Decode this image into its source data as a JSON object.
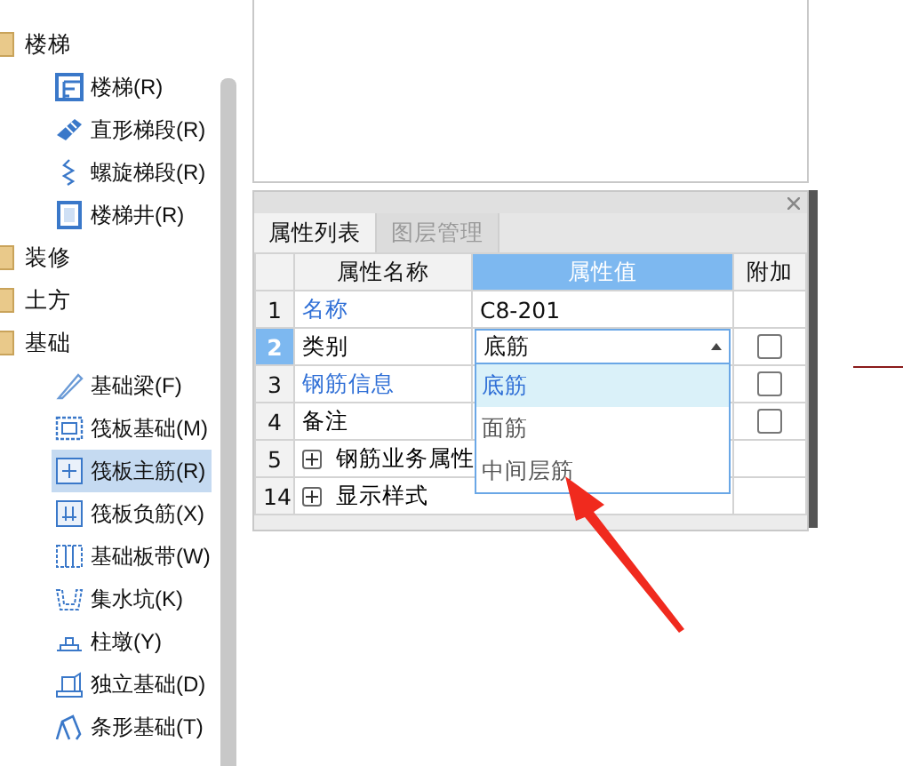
{
  "sidebar": {
    "items": [
      {
        "label": "楼梯",
        "children": [
          {
            "label": "楼梯(R)",
            "selected": false
          },
          {
            "label": "直形梯段(R)",
            "selected": false
          },
          {
            "label": "螺旋梯段(R)",
            "selected": false
          },
          {
            "label": "楼梯井(R)",
            "selected": false
          }
        ]
      },
      {
        "label": "装修"
      },
      {
        "label": "土方"
      },
      {
        "label": "基础",
        "children": [
          {
            "label": "基础梁(F)",
            "selected": false
          },
          {
            "label": "筏板基础(M)",
            "selected": false
          },
          {
            "label": "筏板主筋(R)",
            "selected": true
          },
          {
            "label": "筏板负筋(X)",
            "selected": false
          },
          {
            "label": "基础板带(W)",
            "selected": false
          },
          {
            "label": "集水坑(K)",
            "selected": false
          },
          {
            "label": "柱墩(Y)",
            "selected": false
          },
          {
            "label": "独立基础(D)",
            "selected": false
          },
          {
            "label": "条形基础(T)",
            "selected": false
          }
        ]
      }
    ]
  },
  "properties": {
    "tabs": [
      {
        "label": "属性列表",
        "selected": true
      },
      {
        "label": "图层管理",
        "selected": false
      }
    ],
    "columns": [
      {
        "label": "属性名称",
        "selected": false
      },
      {
        "label": "属性值",
        "selected": true
      },
      {
        "label": "附加",
        "selected": false
      }
    ],
    "rows": [
      {
        "number": "1",
        "name": "名称",
        "color": "#2f6fd6",
        "value": "C8-201",
        "selected": false
      },
      {
        "number": "2",
        "name": "类别",
        "color": "#000000",
        "value": "底筋",
        "selected": true,
        "checked": false,
        "dropdown": {
          "open": true,
          "options": [
            {
              "label": "底筋",
              "selected": true
            },
            {
              "label": "面筋",
              "selected": false
            },
            {
              "label": "中间层筋",
              "selected": false
            }
          ]
        }
      },
      {
        "number": "3",
        "name": "钢筋信息",
        "color": "#2f6fd6",
        "selected": false,
        "checked": false
      },
      {
        "number": "4",
        "name": "备注",
        "color": "#000000",
        "selected": false,
        "checked": false
      },
      {
        "number": "5",
        "name": "钢筋业务属性",
        "color": "#000000",
        "selected": false,
        "expanded": false
      },
      {
        "number": "14",
        "name": "显示样式",
        "color": "#000000",
        "selected": false,
        "expanded": false
      }
    ]
  }
}
